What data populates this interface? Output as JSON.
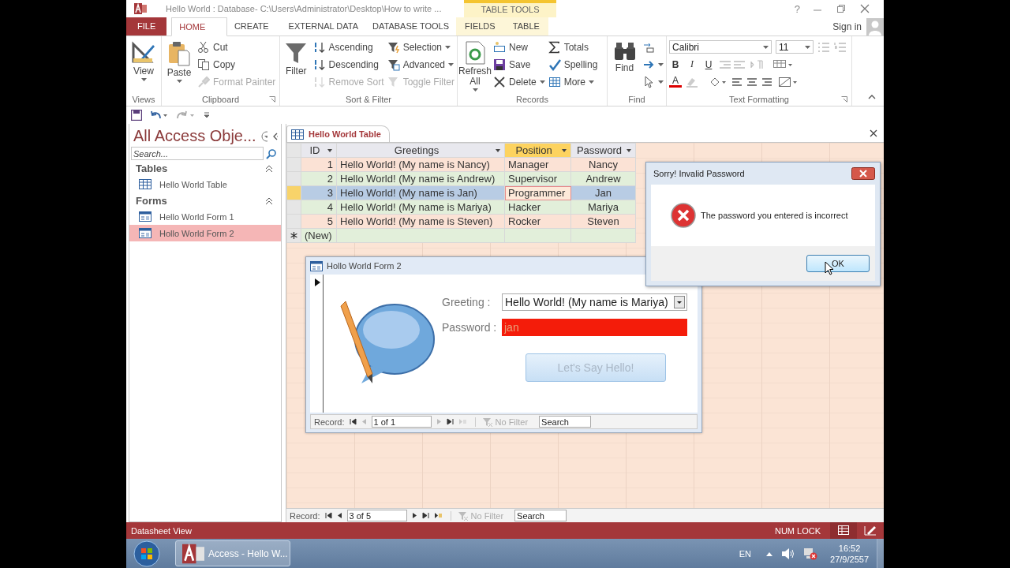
{
  "window": {
    "title": "Hello World : Database- C:\\Users\\Administrator\\Desktop\\How to write ...",
    "context_group": "TABLE TOOLS",
    "help": "?",
    "sign_in": "Sign in"
  },
  "ribbon_tabs": [
    {
      "label": "FILE",
      "kind": "file",
      "selected": false
    },
    {
      "label": "HOME",
      "kind": "main",
      "selected": true
    },
    {
      "label": "CREATE",
      "kind": "main",
      "selected": false
    },
    {
      "label": "EXTERNAL DATA",
      "kind": "main",
      "selected": false
    },
    {
      "label": "DATABASE TOOLS",
      "kind": "main",
      "selected": false
    },
    {
      "label": "FIELDS",
      "kind": "context",
      "selected": false
    },
    {
      "label": "TABLE",
      "kind": "context",
      "selected": false
    }
  ],
  "ribbon_groups": [
    {
      "label": "Views",
      "launcher": false,
      "large": [
        {
          "kind": "view",
          "label": "View",
          "dropdown": true
        }
      ]
    },
    {
      "label": "Clipboard",
      "launcher": true,
      "large": [
        {
          "kind": "paste",
          "label": "Paste",
          "dropdown": true
        }
      ],
      "columns": [
        [
          {
            "kind": "cut",
            "label": "Cut",
            "disabled": false,
            "dropdown": false
          },
          {
            "kind": "copy",
            "label": "Copy",
            "disabled": false,
            "dropdown": false
          },
          {
            "kind": "painter",
            "label": "Format Painter",
            "disabled": true,
            "dropdown": false
          }
        ]
      ]
    },
    {
      "label": "Sort & Filter",
      "launcher": false,
      "large": [
        {
          "kind": "filter",
          "label": "Filter",
          "dropdown": false
        }
      ],
      "columns": [
        [
          {
            "kind": "ascending",
            "label": "Ascending",
            "disabled": false,
            "dropdown": false
          },
          {
            "kind": "descending",
            "label": "Descending",
            "disabled": false,
            "dropdown": false
          },
          {
            "kind": "removesort",
            "label": "Remove Sort",
            "disabled": true,
            "dropdown": false
          }
        ],
        [
          {
            "kind": "selection",
            "label": "Selection",
            "disabled": false,
            "dropdown": true
          },
          {
            "kind": "advanced",
            "label": "Advanced",
            "disabled": false,
            "dropdown": true
          },
          {
            "kind": "toggle",
            "label": "Toggle Filter",
            "disabled": true,
            "dropdown": false
          }
        ]
      ]
    },
    {
      "label": "Records",
      "launcher": false,
      "large": [
        {
          "kind": "refresh",
          "label": "Refresh All",
          "dropdown": true
        }
      ],
      "columns": [
        [
          {
            "kind": "new",
            "label": "New",
            "disabled": false,
            "dropdown": false
          },
          {
            "kind": "save",
            "label": "Save",
            "disabled": false,
            "dropdown": false
          },
          {
            "kind": "delete",
            "label": "Delete",
            "disabled": false,
            "dropdown": true
          }
        ],
        [
          {
            "kind": "totals",
            "label": "Totals",
            "disabled": false,
            "dropdown": false
          },
          {
            "kind": "spelling",
            "label": "Spelling",
            "disabled": false,
            "dropdown": false
          },
          {
            "kind": "more",
            "label": "More",
            "disabled": false,
            "dropdown": true
          }
        ]
      ]
    },
    {
      "label": "Find",
      "launcher": false,
      "large": [
        {
          "kind": "find",
          "label": "Find",
          "dropdown": false
        }
      ],
      "columns": [
        [
          {
            "kind": "replace",
            "disabled": false,
            "dropdown": false
          },
          {
            "kind": "goto",
            "disabled": false,
            "dropdown": true
          },
          {
            "kind": "select",
            "disabled": false,
            "dropdown": true
          }
        ]
      ]
    }
  ],
  "text_formatting": {
    "label": "Text Formatting",
    "launcher": true,
    "font": "Calibri",
    "size": "11",
    "bold": "B",
    "italic": "I",
    "underline": "U",
    "font_color": "A"
  },
  "navigation_pane": {
    "title": "All Access Obje...",
    "search_placeholder": "Search...",
    "sections": [
      {
        "label": "Tables",
        "expanded": true,
        "items": [
          {
            "kind": "table",
            "label": "Hello World Table",
            "selected": false
          }
        ]
      },
      {
        "label": "Forms",
        "expanded": true,
        "items": [
          {
            "kind": "form",
            "label": "Hello World Form 1",
            "selected": false
          },
          {
            "kind": "form",
            "label": "Hollo World Form 2",
            "selected": true
          }
        ]
      }
    ]
  },
  "document_tab": {
    "label": "Hello World Table"
  },
  "datasheet": {
    "columns": [
      {
        "label": "ID",
        "selected": false
      },
      {
        "label": "Greetings",
        "selected": false
      },
      {
        "label": "Position",
        "selected": true
      },
      {
        "label": "Password",
        "selected": false
      }
    ],
    "rows": [
      {
        "cells": [
          "1",
          "Hello World! (My name is Nancy)",
          "Manager",
          "Nancy"
        ],
        "selected": false
      },
      {
        "cells": [
          "2",
          "Hello World! (My name is Andrew)",
          "Supervisor",
          "Andrew"
        ],
        "selected": false
      },
      {
        "cells": [
          "3",
          "Hello World! (My name is Jan)",
          "Programmer",
          "Jan"
        ],
        "selected": true
      },
      {
        "cells": [
          "4",
          "Hello World! (My name is Mariya)",
          "Hacker",
          "Mariya"
        ],
        "selected": false
      },
      {
        "cells": [
          "5",
          "Hello World! (My name is Steven)",
          "Rocker",
          "Steven"
        ],
        "selected": false
      }
    ],
    "new_row": "(New)",
    "record_nav": {
      "label": "Record:",
      "position": "3 of 5",
      "filter": "No Filter",
      "search_placeholder": "Search"
    }
  },
  "form_window": {
    "title": "Hollo World Form 2",
    "greeting_label": "Greeting :",
    "greeting_value": "Hello World! (My name is Mariya)",
    "password_label": "Password :",
    "password_value": "jan",
    "password_invalid": true,
    "button": "Let's Say Hello!",
    "record_nav": {
      "label": "Record:",
      "position": "1 of 1",
      "filter": "No Filter",
      "search_placeholder": "Search"
    }
  },
  "dialog": {
    "title": "Sorry! Invalid Password",
    "message": "The password you entered is incorrect",
    "button": "OK"
  },
  "status_bar": {
    "view": "Datasheet View",
    "num_lock": "NUM LOCK"
  },
  "taskbar": {
    "app_button": "Access - Hello W...",
    "language": "EN",
    "time": "16:52",
    "date": "27/9/2557"
  }
}
